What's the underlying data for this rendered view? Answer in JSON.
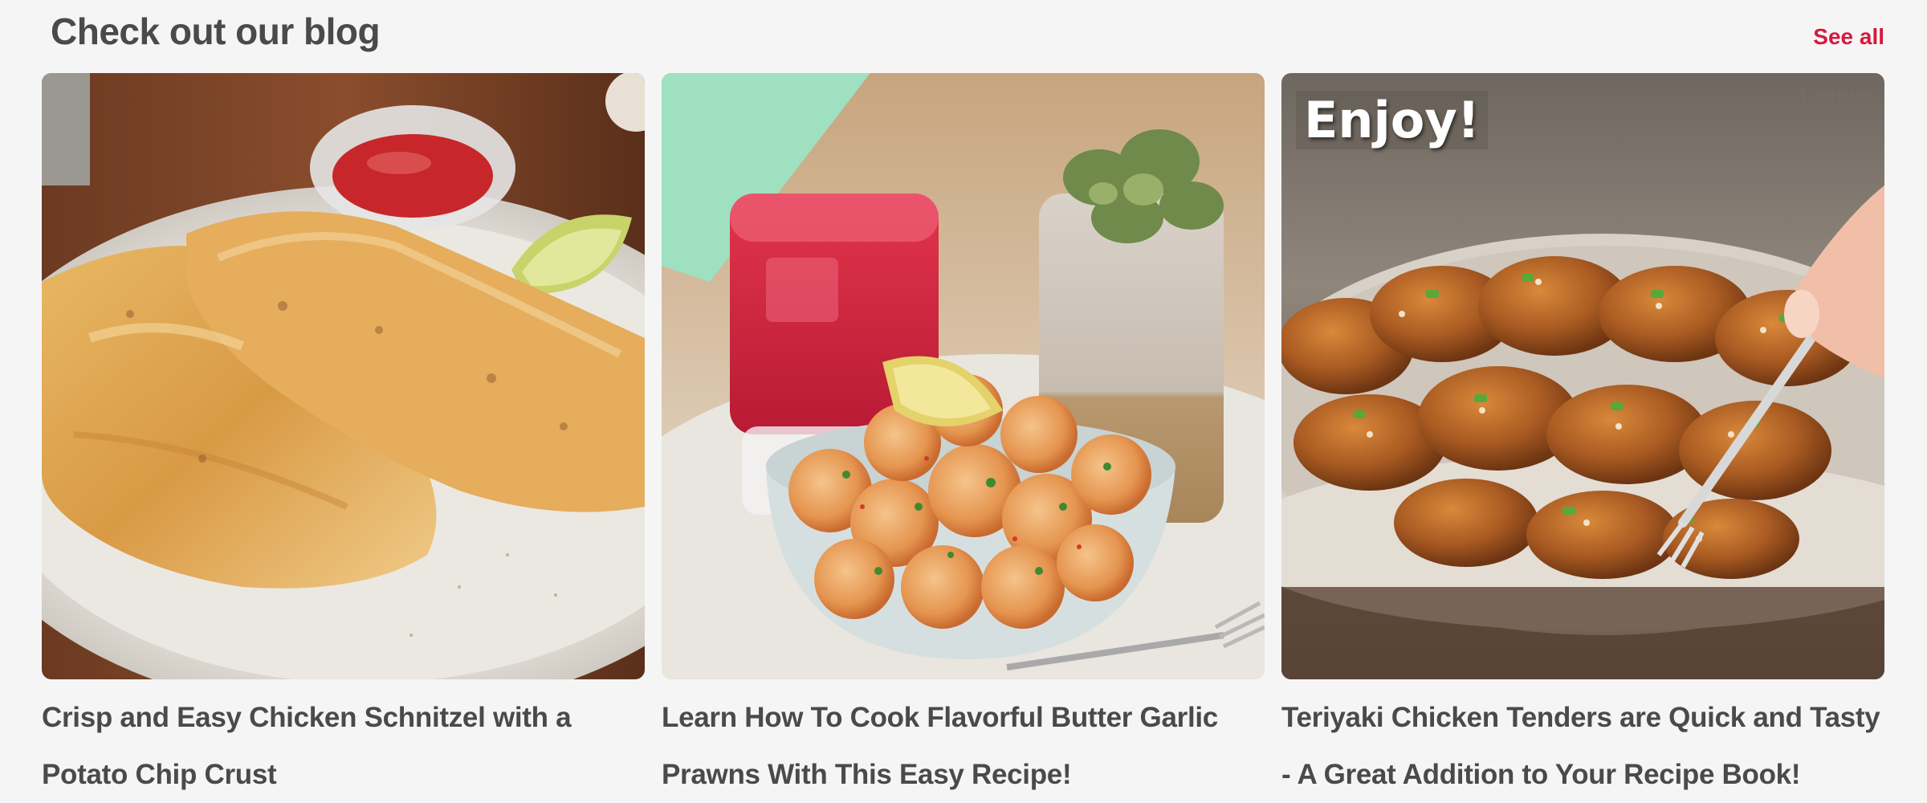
{
  "header": {
    "title": "Check out our blog",
    "see_all_label": "See all"
  },
  "cards": [
    {
      "title": "Crisp and Easy Chicken Schnitzel with a Potato Chip Crust",
      "image": "chicken-schnitzel-photo"
    },
    {
      "title": "Learn How To Cook Flavorful Butter Garlic Prawns With This Easy Recipe!",
      "image": "butter-garlic-prawns-photo"
    },
    {
      "title": "Teriyaki Chicken Tenders are Quick and Tasty - A Great Addition to Your Recipe Book!",
      "image": "teriyaki-chicken-tenders-photo",
      "overlay_text": "Enjoy!",
      "watermark": "Licious"
    }
  ],
  "colors": {
    "accent": "#d7193f",
    "title_text": "#4a4a4a",
    "background": "#f5f5f5"
  }
}
